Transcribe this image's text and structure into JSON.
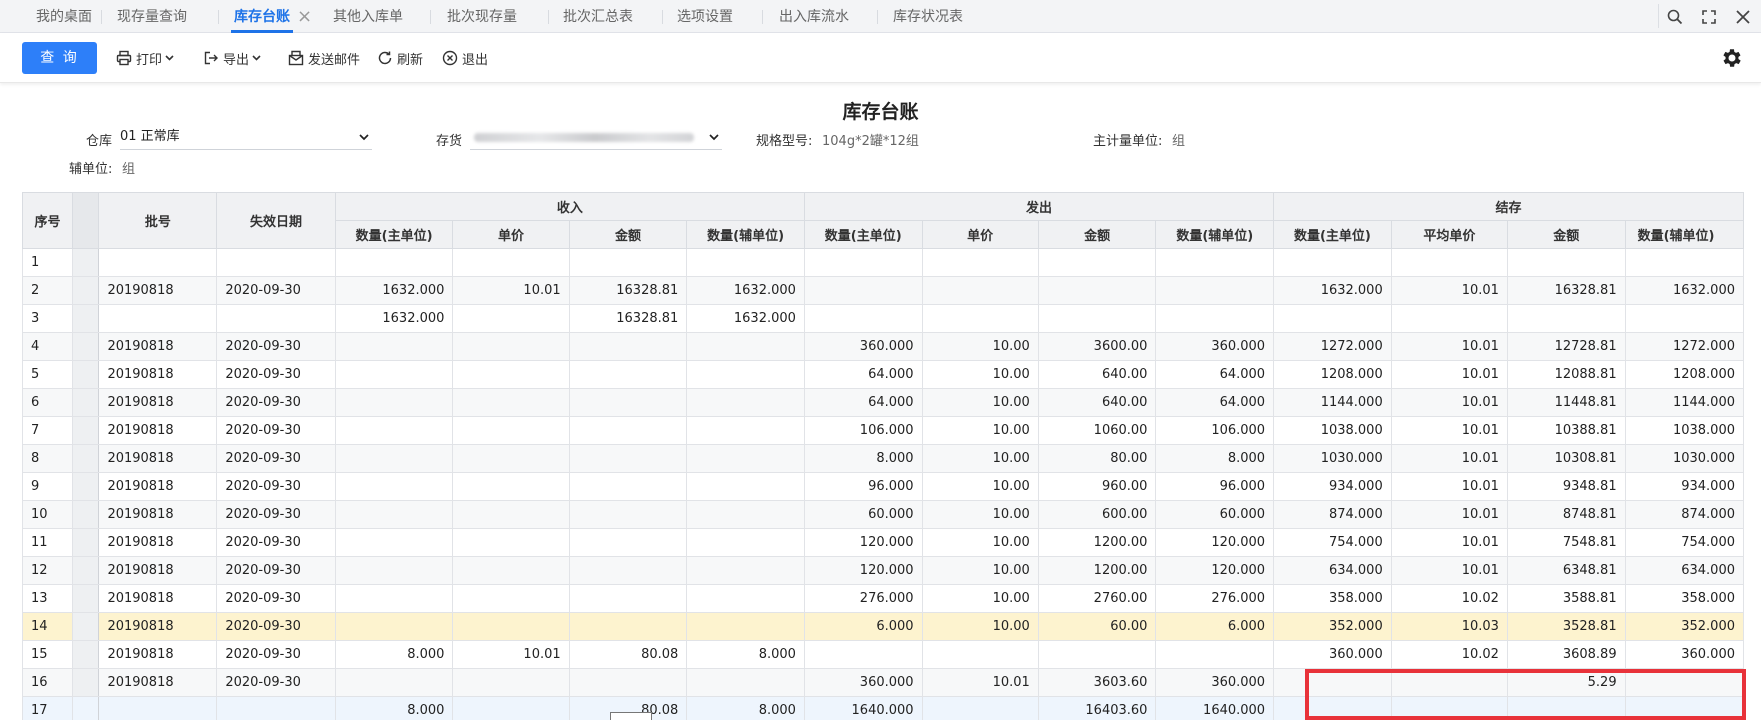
{
  "tabs": [
    {
      "label": "我的桌面"
    },
    {
      "label": "现存量查询"
    },
    {
      "label": "库存台账",
      "active": true,
      "closable": true
    },
    {
      "label": "其他入库单"
    },
    {
      "label": "批次现存量"
    },
    {
      "label": "批次汇总表"
    },
    {
      "label": "选项设置"
    },
    {
      "label": "出入库流水"
    },
    {
      "label": "库存状况表"
    }
  ],
  "tab_close_glyph": "×",
  "window_icons": [
    "search-icon",
    "fullscreen-icon",
    "close-icon"
  ],
  "toolbar": {
    "query": "查 询",
    "print": "打印",
    "export": "导出",
    "email": "发送邮件",
    "refresh": "刷新",
    "exit": "退出"
  },
  "page": {
    "title": "库存台账",
    "warehouse_label": "仓库",
    "warehouse_value": "01 正常库",
    "item_label": "存货",
    "spec_label": "规格型号:",
    "spec_value": "104g*2罐*12组",
    "main_unit_label": "主计量单位:",
    "main_unit_value": "组",
    "aux_unit_label": "辅单位:",
    "aux_unit_value": "组"
  },
  "table": {
    "headers": {
      "seq": "序号",
      "batch": "批号",
      "expiry": "失效日期",
      "in_group": "收入",
      "out_group": "发出",
      "bal_group": "结存",
      "qty_main": "数量(主单位)",
      "price": "单价",
      "amount": "金额",
      "qty_aux": "数量(辅单位)",
      "avg_price": "平均单价"
    },
    "rows": [
      {
        "seq": "1",
        "batch": "",
        "expiry": "",
        "in": [
          "",
          "",
          "",
          ""
        ],
        "out": [
          "",
          "",
          "",
          ""
        ],
        "bal": [
          "",
          "",
          "",
          ""
        ]
      },
      {
        "seq": "2",
        "batch": "20190818",
        "expiry": "2020-09-30",
        "in": [
          "1632.000",
          "10.01",
          "16328.81",
          "1632.000"
        ],
        "out": [
          "",
          "",
          "",
          ""
        ],
        "bal": [
          "1632.000",
          "10.01",
          "16328.81",
          "1632.000"
        ]
      },
      {
        "seq": "3",
        "batch": "",
        "expiry": "",
        "in": [
          "1632.000",
          "",
          "16328.81",
          "1632.000"
        ],
        "out": [
          "",
          "",
          "",
          ""
        ],
        "bal": [
          "",
          "",
          "",
          ""
        ]
      },
      {
        "seq": "4",
        "batch": "20190818",
        "expiry": "2020-09-30",
        "in": [
          "",
          "",
          "",
          ""
        ],
        "out": [
          "360.000",
          "10.00",
          "3600.00",
          "360.000"
        ],
        "bal": [
          "1272.000",
          "10.01",
          "12728.81",
          "1272.000"
        ]
      },
      {
        "seq": "5",
        "batch": "20190818",
        "expiry": "2020-09-30",
        "in": [
          "",
          "",
          "",
          ""
        ],
        "out": [
          "64.000",
          "10.00",
          "640.00",
          "64.000"
        ],
        "bal": [
          "1208.000",
          "10.01",
          "12088.81",
          "1208.000"
        ]
      },
      {
        "seq": "6",
        "batch": "20190818",
        "expiry": "2020-09-30",
        "in": [
          "",
          "",
          "",
          ""
        ],
        "out": [
          "64.000",
          "10.00",
          "640.00",
          "64.000"
        ],
        "bal": [
          "1144.000",
          "10.01",
          "11448.81",
          "1144.000"
        ]
      },
      {
        "seq": "7",
        "batch": "20190818",
        "expiry": "2020-09-30",
        "in": [
          "",
          "",
          "",
          ""
        ],
        "out": [
          "106.000",
          "10.00",
          "1060.00",
          "106.000"
        ],
        "bal": [
          "1038.000",
          "10.01",
          "10388.81",
          "1038.000"
        ]
      },
      {
        "seq": "8",
        "batch": "20190818",
        "expiry": "2020-09-30",
        "in": [
          "",
          "",
          "",
          ""
        ],
        "out": [
          "8.000",
          "10.00",
          "80.00",
          "8.000"
        ],
        "bal": [
          "1030.000",
          "10.01",
          "10308.81",
          "1030.000"
        ]
      },
      {
        "seq": "9",
        "batch": "20190818",
        "expiry": "2020-09-30",
        "in": [
          "",
          "",
          "",
          ""
        ],
        "out": [
          "96.000",
          "10.00",
          "960.00",
          "96.000"
        ],
        "bal": [
          "934.000",
          "10.01",
          "9348.81",
          "934.000"
        ]
      },
      {
        "seq": "10",
        "batch": "20190818",
        "expiry": "2020-09-30",
        "in": [
          "",
          "",
          "",
          ""
        ],
        "out": [
          "60.000",
          "10.00",
          "600.00",
          "60.000"
        ],
        "bal": [
          "874.000",
          "10.01",
          "8748.81",
          "874.000"
        ]
      },
      {
        "seq": "11",
        "batch": "20190818",
        "expiry": "2020-09-30",
        "in": [
          "",
          "",
          "",
          ""
        ],
        "out": [
          "120.000",
          "10.00",
          "1200.00",
          "120.000"
        ],
        "bal": [
          "754.000",
          "10.01",
          "7548.81",
          "754.000"
        ]
      },
      {
        "seq": "12",
        "batch": "20190818",
        "expiry": "2020-09-30",
        "in": [
          "",
          "",
          "",
          ""
        ],
        "out": [
          "120.000",
          "10.00",
          "1200.00",
          "120.000"
        ],
        "bal": [
          "634.000",
          "10.01",
          "6348.81",
          "634.000"
        ]
      },
      {
        "seq": "13",
        "batch": "20190818",
        "expiry": "2020-09-30",
        "in": [
          "",
          "",
          "",
          ""
        ],
        "out": [
          "276.000",
          "10.00",
          "2760.00",
          "276.000"
        ],
        "bal": [
          "358.000",
          "10.02",
          "3588.81",
          "358.000"
        ]
      },
      {
        "seq": "14",
        "batch": "20190818",
        "expiry": "2020-09-30",
        "in": [
          "",
          "",
          "",
          ""
        ],
        "out": [
          "6.000",
          "10.00",
          "60.00",
          "6.000"
        ],
        "bal": [
          "352.000",
          "10.03",
          "3528.81",
          "352.000"
        ],
        "highlight": true
      },
      {
        "seq": "15",
        "batch": "20190818",
        "expiry": "2020-09-30",
        "in": [
          "8.000",
          "10.01",
          "80.08",
          "8.000"
        ],
        "out": [
          "",
          "",
          "",
          ""
        ],
        "bal": [
          "360.000",
          "10.02",
          "3608.89",
          "360.000"
        ]
      },
      {
        "seq": "16",
        "batch": "20190818",
        "expiry": "2020-09-30",
        "in": [
          "",
          "",
          "",
          ""
        ],
        "out": [
          "360.000",
          "10.01",
          "3603.60",
          "360.000"
        ],
        "bal": [
          "",
          "",
          "5.29",
          ""
        ]
      },
      {
        "seq": "17",
        "batch": "",
        "expiry": "",
        "in": [
          "8.000",
          "",
          "80.08",
          "8.000"
        ],
        "out": [
          "1640.000",
          "",
          "16403.60",
          "1640.000"
        ],
        "bal": [
          "",
          "",
          "",
          ""
        ],
        "total": true
      }
    ]
  },
  "colors": {
    "accent": "#2d7ff9",
    "highlight_row": "#fdf3cf",
    "annotation_box": "#e8323a"
  }
}
